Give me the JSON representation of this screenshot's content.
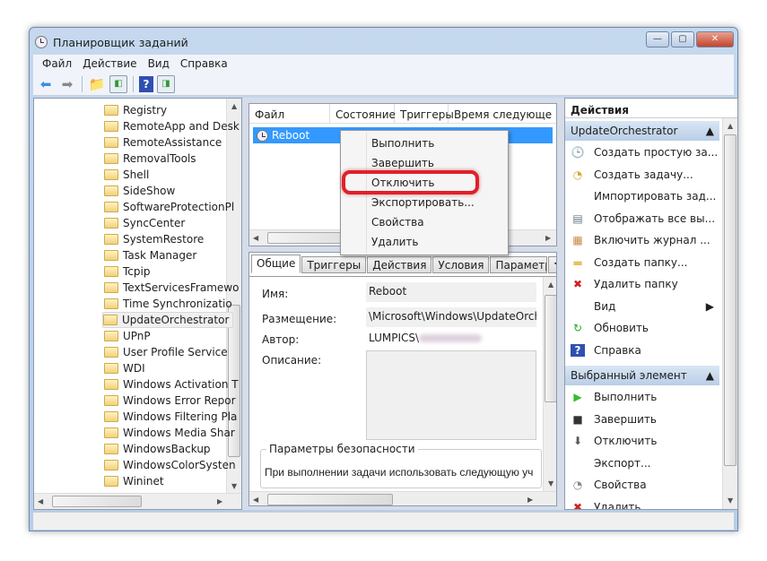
{
  "window": {
    "title": "Планировщик заданий",
    "minimize": "—",
    "maximize": "▢",
    "close": "✕"
  },
  "menu": [
    "Файл",
    "Действие",
    "Вид",
    "Справка"
  ],
  "toolbar": {
    "icons": [
      "back-arrow-icon",
      "forward-arrow-icon",
      "folder-up-icon",
      "show-hide-tree-icon",
      "help-icon",
      "show-hide-actions-icon"
    ]
  },
  "tree": {
    "items": [
      "Registry",
      "RemoteApp and Desk",
      "RemoteAssistance",
      "RemovalTools",
      "Shell",
      "SideShow",
      "SoftwareProtectionPl",
      "SyncCenter",
      "SystemRestore",
      "Task Manager",
      "Tcpip",
      "TextServicesFramewo",
      "Time Synchronizatio",
      "UpdateOrchestrator",
      "UPnP",
      "User Profile Service",
      "WDI",
      "Windows Activation T",
      "Windows Error Repor",
      "Windows Filtering Pla",
      "Windows Media Shar",
      "WindowsBackup",
      "WindowsColorSysten",
      "Wininet"
    ],
    "selected": "UpdateOrchestrator"
  },
  "task_list": {
    "columns": [
      "Файл",
      "Состояние",
      "Триггеры",
      "Время следующе"
    ],
    "rows": [
      {
        "name": "Reboot"
      }
    ]
  },
  "context_menu": {
    "items": [
      "Выполнить",
      "Завершить",
      "Отключить",
      "Экспортировать...",
      "Свойства",
      "Удалить"
    ],
    "highlighted": "Отключить",
    "highlight_color": "#e0202a"
  },
  "details": {
    "tabs": [
      "Общие",
      "Триггеры",
      "Действия",
      "Условия",
      "Параметры"
    ],
    "active_tab": "Общие",
    "name_label": "Имя:",
    "name_value": "Reboot",
    "location_label": "Размещение:",
    "location_value": "\\Microsoft\\Windows\\UpdateOrches",
    "author_label": "Автор:",
    "author_value": "LUMPICS\\",
    "description_label": "Описание:",
    "security_legend": "Параметры безопасности",
    "security_text": "При выполнении задачи использовать следующую уч"
  },
  "actions": {
    "header": "Действия",
    "group1": {
      "title": "UpdateOrchestrator",
      "items": [
        {
          "label": "Создать простую за...",
          "icon": "create-basic-task-icon"
        },
        {
          "label": "Создать задачу...",
          "icon": "create-task-icon"
        },
        {
          "label": "Импортировать зад...",
          "icon": ""
        },
        {
          "label": "Отображать все вы...",
          "icon": "display-running-icon"
        },
        {
          "label": "Включить журнал ...",
          "icon": "enable-log-icon"
        },
        {
          "label": "Создать папку...",
          "icon": "new-folder-icon"
        },
        {
          "label": "Удалить папку",
          "icon": "delete-icon"
        },
        {
          "label": "Вид",
          "icon": "",
          "submenu": true
        },
        {
          "label": "Обновить",
          "icon": "refresh-icon"
        },
        {
          "label": "Справка",
          "icon": "help-icon"
        }
      ]
    },
    "group2": {
      "title": "Выбранный элемент",
      "items": [
        {
          "label": "Выполнить",
          "icon": "play-icon"
        },
        {
          "label": "Завершить",
          "icon": "stop-icon"
        },
        {
          "label": "Отключить",
          "icon": "disable-arrow-icon"
        },
        {
          "label": "Экспорт...",
          "icon": ""
        },
        {
          "label": "Свойства",
          "icon": "properties-icon"
        },
        {
          "label": "Удалить",
          "icon": "delete-icon"
        }
      ]
    }
  }
}
